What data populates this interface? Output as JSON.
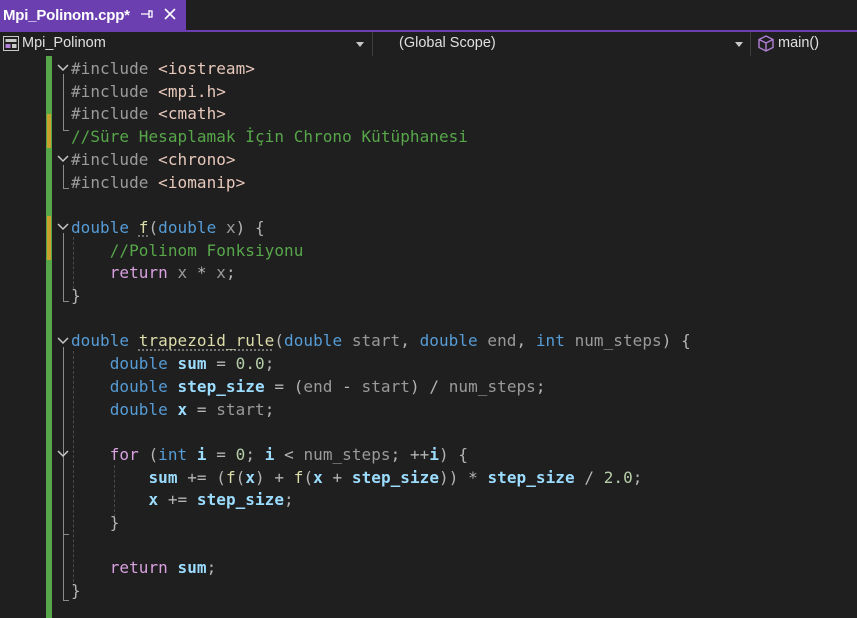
{
  "tab": {
    "title": "Mpi_Polinom.cpp*"
  },
  "navbar": {
    "project": "Mpi_Polinom",
    "scope": "(Global Scope)",
    "member": "main()"
  },
  "code": [
    [
      [
        "pp",
        "#include "
      ],
      [
        "inc",
        "<iostream>"
      ]
    ],
    [
      [
        "pp",
        "#include "
      ],
      [
        "inc",
        "<mpi.h>"
      ]
    ],
    [
      [
        "pp",
        "#include "
      ],
      [
        "inc",
        "<cmath>"
      ]
    ],
    [
      [
        "cm",
        "//Süre Hesaplamak İçin Chrono Kütüphanesi"
      ]
    ],
    [
      [
        "pp",
        "#include "
      ],
      [
        "inc",
        "<chrono>"
      ]
    ],
    [
      [
        "pp",
        "#include "
      ],
      [
        "inc",
        "<iomanip>"
      ]
    ],
    [],
    [
      [
        "kw",
        "double "
      ],
      [
        "fnu",
        "f"
      ],
      [
        "pn",
        "("
      ],
      [
        "kw",
        "double "
      ],
      [
        "param",
        "x"
      ],
      [
        "pn",
        ") {"
      ]
    ],
    [
      [
        "pn",
        "    "
      ],
      [
        "cm",
        "//Polinom Fonksiyonu"
      ]
    ],
    [
      [
        "pn",
        "    "
      ],
      [
        "ctl",
        "return "
      ],
      [
        "param",
        "x"
      ],
      [
        "op",
        " * "
      ],
      [
        "param",
        "x"
      ],
      [
        "pn",
        ";"
      ]
    ],
    [
      [
        "pn",
        "}"
      ]
    ],
    [],
    [
      [
        "kw",
        "double "
      ],
      [
        "fnu",
        "trapezoid_rule"
      ],
      [
        "pn",
        "("
      ],
      [
        "kw",
        "double "
      ],
      [
        "param",
        "start"
      ],
      [
        "pn",
        ", "
      ],
      [
        "kw",
        "double "
      ],
      [
        "param",
        "end"
      ],
      [
        "pn",
        ", "
      ],
      [
        "kw",
        "int "
      ],
      [
        "param",
        "num_steps"
      ],
      [
        "pn",
        ") {"
      ]
    ],
    [
      [
        "pn",
        "    "
      ],
      [
        "kw",
        "double "
      ],
      [
        "varb",
        "sum"
      ],
      [
        "op",
        " = "
      ],
      [
        "num",
        "0.0"
      ],
      [
        "pn",
        ";"
      ]
    ],
    [
      [
        "pn",
        "    "
      ],
      [
        "kw",
        "double "
      ],
      [
        "varb",
        "step_size"
      ],
      [
        "op",
        " = "
      ],
      [
        "pn",
        "("
      ],
      [
        "param",
        "end"
      ],
      [
        "op",
        " - "
      ],
      [
        "param",
        "start"
      ],
      [
        "pn",
        ") "
      ],
      [
        "op",
        "/ "
      ],
      [
        "param",
        "num_steps"
      ],
      [
        "pn",
        ";"
      ]
    ],
    [
      [
        "pn",
        "    "
      ],
      [
        "kw",
        "double "
      ],
      [
        "varb",
        "x"
      ],
      [
        "op",
        " = "
      ],
      [
        "param",
        "start"
      ],
      [
        "pn",
        ";"
      ]
    ],
    [],
    [
      [
        "pn",
        "    "
      ],
      [
        "ctl",
        "for "
      ],
      [
        "pn",
        "("
      ],
      [
        "kw",
        "int "
      ],
      [
        "varb",
        "i"
      ],
      [
        "op",
        " = "
      ],
      [
        "num",
        "0"
      ],
      [
        "pn",
        "; "
      ],
      [
        "varb",
        "i"
      ],
      [
        "op",
        " < "
      ],
      [
        "param",
        "num_steps"
      ],
      [
        "pn",
        "; "
      ],
      [
        "op",
        "++"
      ],
      [
        "varb",
        "i"
      ],
      [
        "pn",
        ") {"
      ]
    ],
    [
      [
        "pn",
        "        "
      ],
      [
        "varb",
        "sum"
      ],
      [
        "op",
        " += "
      ],
      [
        "pn",
        "("
      ],
      [
        "fn",
        "f"
      ],
      [
        "pn",
        "("
      ],
      [
        "varb",
        "x"
      ],
      [
        "pn",
        ")"
      ],
      [
        "op",
        " + "
      ],
      [
        "fn",
        "f"
      ],
      [
        "pn",
        "("
      ],
      [
        "varb",
        "x"
      ],
      [
        "op",
        " + "
      ],
      [
        "varb",
        "step_size"
      ],
      [
        "pn",
        "))"
      ],
      [
        "op",
        " * "
      ],
      [
        "varb",
        "step_size"
      ],
      [
        "op",
        " / "
      ],
      [
        "num",
        "2.0"
      ],
      [
        "pn",
        ";"
      ]
    ],
    [
      [
        "pn",
        "        "
      ],
      [
        "varb",
        "x"
      ],
      [
        "op",
        " += "
      ],
      [
        "varb",
        "step_size"
      ],
      [
        "pn",
        ";"
      ]
    ],
    [
      [
        "pn",
        "    }"
      ]
    ],
    [],
    [
      [
        "pn",
        "    "
      ],
      [
        "ctl",
        "return "
      ],
      [
        "varb",
        "sum"
      ],
      [
        "pn",
        ";"
      ]
    ],
    [
      [
        "pn",
        "}"
      ]
    ]
  ]
}
